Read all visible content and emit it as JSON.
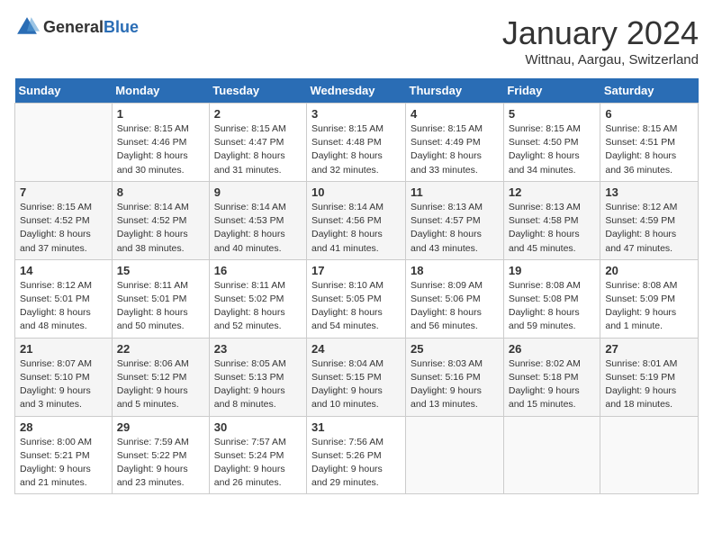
{
  "header": {
    "logo_general": "General",
    "logo_blue": "Blue",
    "month_title": "January 2024",
    "location": "Wittnau, Aargau, Switzerland"
  },
  "days_of_week": [
    "Sunday",
    "Monday",
    "Tuesday",
    "Wednesday",
    "Thursday",
    "Friday",
    "Saturday"
  ],
  "weeks": [
    [
      {
        "day": "",
        "info": ""
      },
      {
        "day": "1",
        "info": "Sunrise: 8:15 AM\nSunset: 4:46 PM\nDaylight: 8 hours\nand 30 minutes."
      },
      {
        "day": "2",
        "info": "Sunrise: 8:15 AM\nSunset: 4:47 PM\nDaylight: 8 hours\nand 31 minutes."
      },
      {
        "day": "3",
        "info": "Sunrise: 8:15 AM\nSunset: 4:48 PM\nDaylight: 8 hours\nand 32 minutes."
      },
      {
        "day": "4",
        "info": "Sunrise: 8:15 AM\nSunset: 4:49 PM\nDaylight: 8 hours\nand 33 minutes."
      },
      {
        "day": "5",
        "info": "Sunrise: 8:15 AM\nSunset: 4:50 PM\nDaylight: 8 hours\nand 34 minutes."
      },
      {
        "day": "6",
        "info": "Sunrise: 8:15 AM\nSunset: 4:51 PM\nDaylight: 8 hours\nand 36 minutes."
      }
    ],
    [
      {
        "day": "7",
        "info": ""
      },
      {
        "day": "8",
        "info": "Sunrise: 8:14 AM\nSunset: 4:52 PM\nDaylight: 8 hours\nand 38 minutes."
      },
      {
        "day": "9",
        "info": "Sunrise: 8:14 AM\nSunset: 4:53 PM\nDaylight: 8 hours\nand 40 minutes."
      },
      {
        "day": "10",
        "info": "Sunrise: 8:14 AM\nSunset: 4:56 PM\nDaylight: 8 hours\nand 41 minutes."
      },
      {
        "day": "11",
        "info": "Sunrise: 8:13 AM\nSunset: 4:57 PM\nDaylight: 8 hours\nand 43 minutes."
      },
      {
        "day": "12",
        "info": "Sunrise: 8:13 AM\nSunset: 4:58 PM\nDaylight: 8 hours\nand 45 minutes."
      },
      {
        "day": "13",
        "info": "Sunrise: 8:12 AM\nSunset: 4:59 PM\nDaylight: 8 hours\nand 47 minutes."
      }
    ],
    [
      {
        "day": "14",
        "info": ""
      },
      {
        "day": "15",
        "info": "Sunrise: 8:11 AM\nSunset: 5:01 PM\nDaylight: 8 hours\nand 50 minutes."
      },
      {
        "day": "16",
        "info": "Sunrise: 8:11 AM\nSunset: 5:02 PM\nDaylight: 8 hours\nand 52 minutes."
      },
      {
        "day": "17",
        "info": "Sunrise: 8:10 AM\nSunset: 5:05 PM\nDaylight: 8 hours\nand 54 minutes."
      },
      {
        "day": "18",
        "info": "Sunrise: 8:09 AM\nSunset: 5:06 PM\nDaylight: 8 hours\nand 56 minutes."
      },
      {
        "day": "19",
        "info": "Sunrise: 8:08 AM\nSunset: 5:08 PM\nDaylight: 8 hours\nand 59 minutes."
      },
      {
        "day": "20",
        "info": "Sunrise: 8:08 AM\nSunset: 5:09 PM\nDaylight: 9 hours\nand 1 minute."
      }
    ],
    [
      {
        "day": "21",
        "info": "Sunrise: 8:07 AM\nSunset: 5:10 PM\nDaylight: 9 hours\nand 3 minutes."
      },
      {
        "day": "22",
        "info": "Sunrise: 8:06 AM\nSunset: 5:12 PM\nDaylight: 9 hours\nand 5 minutes."
      },
      {
        "day": "23",
        "info": "Sunrise: 8:05 AM\nSunset: 5:13 PM\nDaylight: 9 hours\nand 8 minutes."
      },
      {
        "day": "24",
        "info": "Sunrise: 8:04 AM\nSunset: 5:15 PM\nDaylight: 9 hours\nand 10 minutes."
      },
      {
        "day": "25",
        "info": "Sunrise: 8:03 AM\nSunset: 5:16 PM\nDaylight: 9 hours\nand 13 minutes."
      },
      {
        "day": "26",
        "info": "Sunrise: 8:02 AM\nSunset: 5:18 PM\nDaylight: 9 hours\nand 15 minutes."
      },
      {
        "day": "27",
        "info": "Sunrise: 8:01 AM\nSunset: 5:19 PM\nDaylight: 9 hours\nand 18 minutes."
      }
    ],
    [
      {
        "day": "28",
        "info": "Sunrise: 8:00 AM\nSunset: 5:21 PM\nDaylight: 9 hours\nand 21 minutes."
      },
      {
        "day": "29",
        "info": "Sunrise: 7:59 AM\nSunset: 5:22 PM\nDaylight: 9 hours\nand 23 minutes."
      },
      {
        "day": "30",
        "info": "Sunrise: 7:57 AM\nSunset: 5:24 PM\nDaylight: 9 hours\nand 26 minutes."
      },
      {
        "day": "31",
        "info": "Sunrise: 7:56 AM\nSunset: 5:26 PM\nDaylight: 9 hours\nand 29 minutes."
      },
      {
        "day": "",
        "info": ""
      },
      {
        "day": "",
        "info": ""
      },
      {
        "day": "",
        "info": ""
      }
    ]
  ],
  "week7_sunday": {
    "info": "Sunrise: 8:15 AM\nSunset: 4:52 PM\nDaylight: 8 hours\nand 37 minutes."
  },
  "week14_sunday": {
    "info": "Sunrise: 8:12 AM\nSunset: 5:01 PM\nDaylight: 8 hours\nand 48 minutes."
  }
}
